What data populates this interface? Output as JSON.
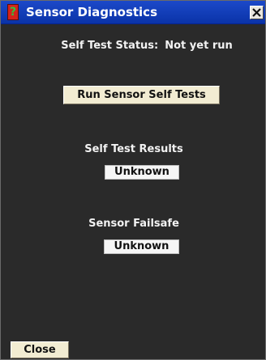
{
  "window": {
    "title": "Sensor Diagnostics",
    "title_bar_color": "#0a33a8",
    "background_color": "#2a2a2a"
  },
  "icons": {
    "app_icon": "question-mark-icon",
    "close_icon": "close-icon",
    "app_icon_glyph": "?"
  },
  "self_test": {
    "status_label": "Self Test Status:",
    "status_value": "Not yet run",
    "run_button_label": "Run Sensor Self Tests"
  },
  "results": {
    "label": "Self Test Results",
    "value": "Unknown"
  },
  "failsafe": {
    "label": "Sensor Failsafe",
    "value": "Unknown"
  },
  "footer": {
    "close_label": "Close"
  }
}
